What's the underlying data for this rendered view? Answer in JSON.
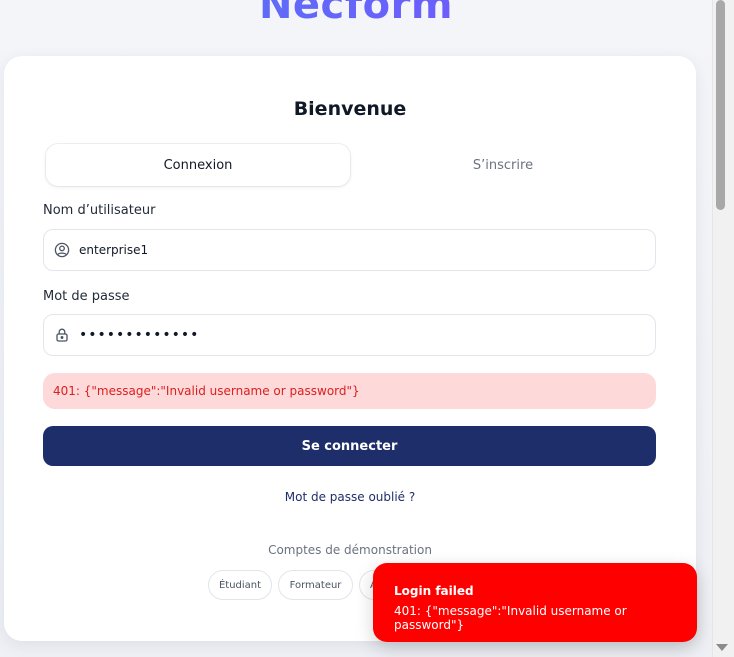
{
  "brand": {
    "logo_text": "Necform"
  },
  "card": {
    "title": "Bienvenue",
    "tabs": [
      {
        "label": "Connexion",
        "active": true
      },
      {
        "label": "S’inscrire",
        "active": false
      }
    ],
    "username": {
      "label": "Nom d’utilisateur",
      "value": "enterprise1",
      "icon": "user-circle-icon"
    },
    "password": {
      "label": "Mot de passe",
      "value": "•••••••••••••",
      "icon": "lock-icon"
    },
    "error_message": "401: {\"message\":\"Invalid username or password\"}",
    "submit_label": "Se connecter",
    "forgot_label": "Mot de passe oublié ?",
    "demo": {
      "title": "Comptes de démonstration",
      "accounts": [
        "Étudiant",
        "Formateur",
        "A"
      ]
    }
  },
  "toast": {
    "title": "Login failed",
    "message": "401: {\"message\":\"Invalid username or password\"}",
    "color": "#ff0000"
  },
  "colors": {
    "primary": "#1e2e6b",
    "error_bg": "#fdd9d9",
    "error_text": "#dc1f1f",
    "logo_gradient_start": "#4f7cf5",
    "logo_gradient_end": "#7c4dff"
  }
}
